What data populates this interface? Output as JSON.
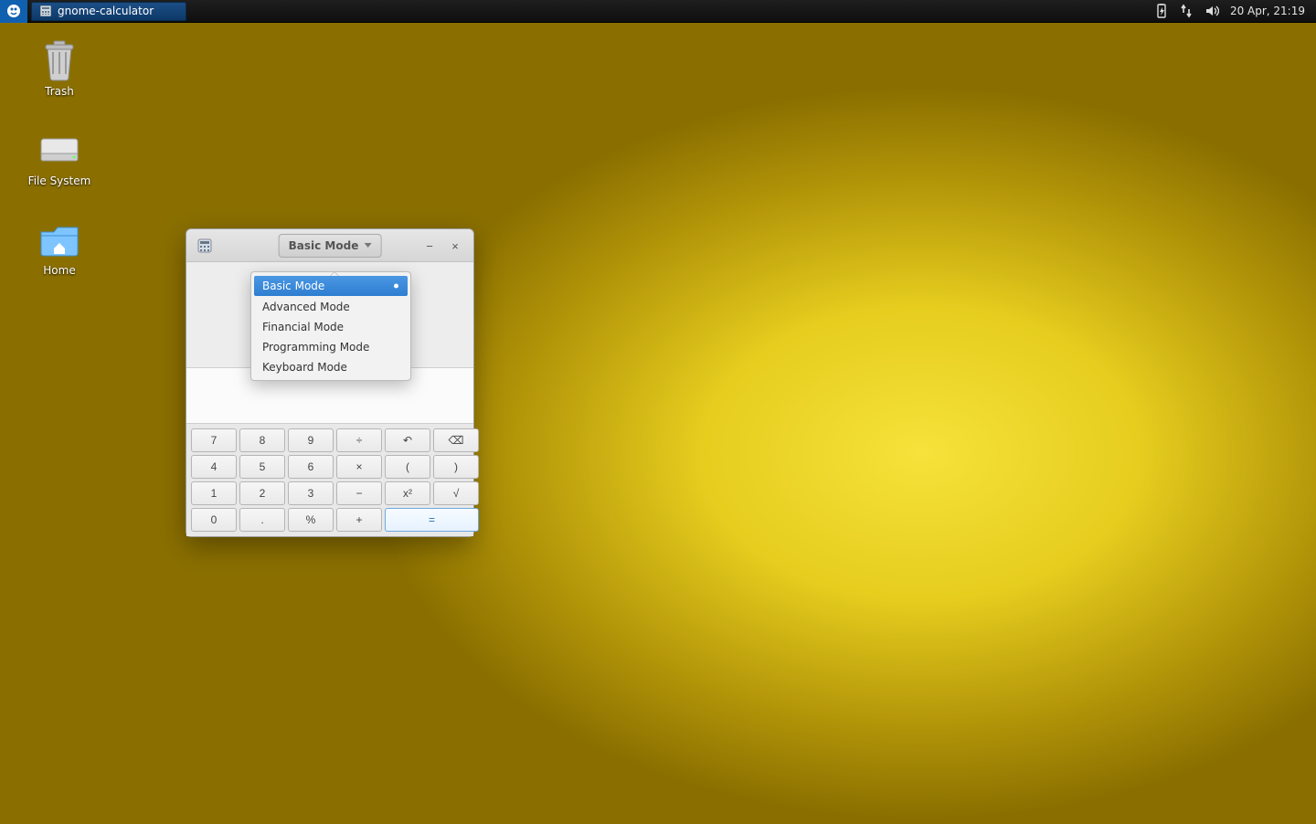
{
  "panel": {
    "task_label": "gnome-calculator",
    "clock": "20 Apr, 21:19"
  },
  "desktop": {
    "trash": "Trash",
    "filesystem": "File System",
    "home": "Home"
  },
  "calc": {
    "mode_button": "Basic Mode",
    "minimize": "−",
    "close": "×",
    "modes": {
      "basic": "Basic Mode",
      "advanced": "Advanced Mode",
      "financial": "Financial Mode",
      "programming": "Programming Mode",
      "keyboard": "Keyboard Mode"
    },
    "keys": {
      "seven": "7",
      "eight": "8",
      "nine": "9",
      "div": "÷",
      "undo": "↶",
      "back": "⌫",
      "four": "4",
      "five": "5",
      "six": "6",
      "mul": "×",
      "lpar": "(",
      "rpar": ")",
      "one": "1",
      "two": "2",
      "three": "3",
      "minus": "−",
      "sq": "x²",
      "sqrt": "√",
      "zero": "0",
      "dot": ".",
      "pct": "%",
      "plus": "+",
      "eq": "="
    }
  }
}
